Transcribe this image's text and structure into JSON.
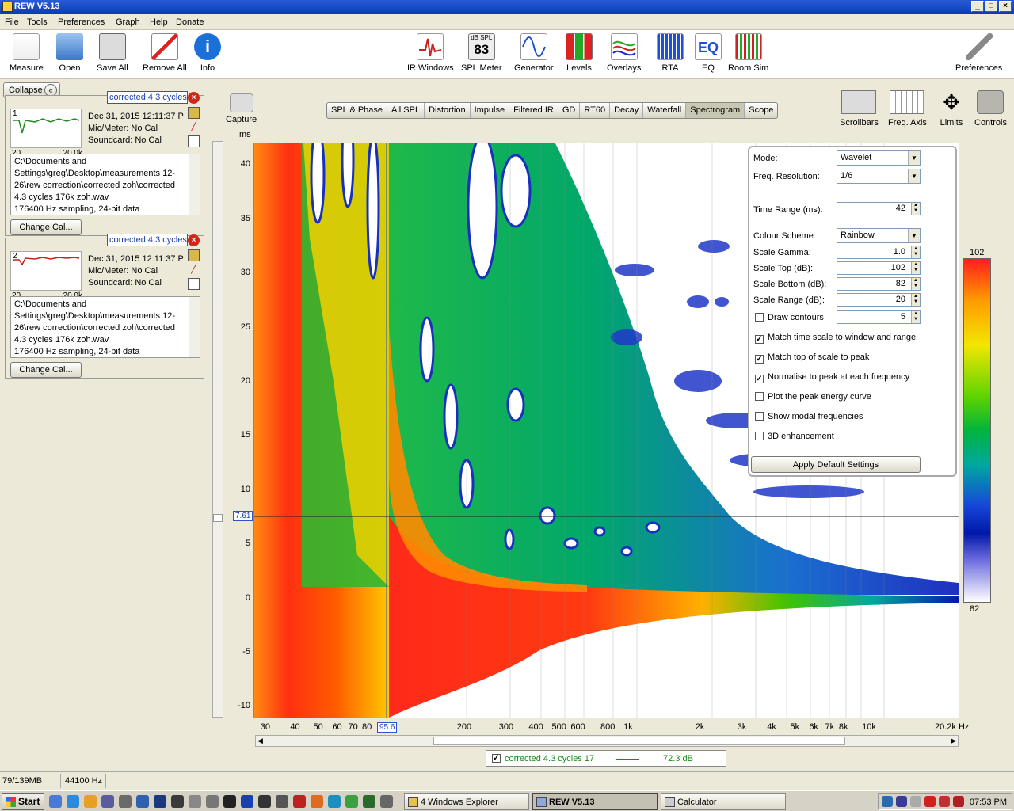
{
  "window": {
    "title": "REW V5.13"
  },
  "menu": [
    "File",
    "Tools",
    "Preferences",
    "Graph",
    "Help",
    "Donate"
  ],
  "toolbar": {
    "left": [
      {
        "label": "Measure",
        "icon": "measure-icon"
      },
      {
        "label": "Open",
        "icon": "folder-icon"
      },
      {
        "label": "Save All",
        "icon": "save-icon"
      },
      {
        "label": "Remove All",
        "icon": "remove-all-icon"
      },
      {
        "label": "Info",
        "icon": "info-icon"
      }
    ],
    "center": [
      {
        "label": "IR Windows",
        "icon": "ir-windows-icon"
      },
      {
        "label": "SPL Meter",
        "icon": "spl-meter-icon",
        "badge_top": "dB SPL",
        "badge_value": "83"
      },
      {
        "label": "Generator",
        "icon": "generator-icon"
      },
      {
        "label": "Levels",
        "icon": "levels-icon"
      },
      {
        "label": "Overlays",
        "icon": "overlays-icon"
      },
      {
        "label": "RTA",
        "icon": "rta-icon"
      },
      {
        "label": "EQ",
        "icon": "eq-icon"
      },
      {
        "label": "Room Sim",
        "icon": "room-sim-icon"
      }
    ],
    "right": {
      "label": "Preferences",
      "icon": "wrench-icon"
    }
  },
  "leftpanel": {
    "collapse_label": "Collapse",
    "measurements": [
      {
        "index": "1",
        "name": "corrected 4.3 cycles 17",
        "date": "Dec 31, 2015 12:11:37 P",
        "mic": "Mic/Meter: No Cal",
        "soundcard": "Soundcard: No Cal",
        "thumb_left": "20",
        "thumb_right": "20.0k",
        "path": "C:\\Documents and Settings\\greg\\Desktop\\measurements 12-26\\rew correction\\corrected zoh\\corrected 4.3 cycles 176k zoh.wav",
        "sampling": "176400 Hz sampling, 24-bit data",
        "change_cal": "Change Cal...",
        "trace_color": "#1f8a1f"
      },
      {
        "index": "2",
        "name": "corrected 4.3 cycles 17",
        "date": "Dec 31, 2015 12:11:37 P",
        "mic": "Mic/Meter: No Cal",
        "soundcard": "Soundcard: No Cal",
        "thumb_left": "20",
        "thumb_right": "20.0k",
        "path": "C:\\Documents and Settings\\greg\\Desktop\\measurements 12-26\\rew correction\\corrected zoh\\corrected 4.3 cycles 176k zoh.wav",
        "sampling": "176400 Hz sampling, 24-bit data",
        "change_cal": "Change Cal...",
        "trace_color": "#c0201a"
      }
    ]
  },
  "graph": {
    "capture_label": "Capture",
    "tabs": [
      "SPL & Phase",
      "All SPL",
      "Distortion",
      "Impulse",
      "Filtered IR",
      "GD",
      "RT60",
      "Decay",
      "Waterfall",
      "Spectrogram",
      "Scope"
    ],
    "active_tab": "Spectrogram",
    "right_buttons": [
      "Scrollbars",
      "Freq. Axis",
      "Limits",
      "Controls"
    ],
    "y_unit": "ms",
    "y_ticks": [
      "40",
      "35",
      "30",
      "25",
      "20",
      "15",
      "10",
      "5",
      "0",
      "-5",
      "-10"
    ],
    "x_ticks": [
      "30",
      "40",
      "50",
      "60",
      "70",
      "80",
      "200",
      "300",
      "400",
      "500",
      "600",
      "800",
      "1k",
      "2k",
      "3k",
      "4k",
      "5k",
      "6k",
      "7k",
      "8k",
      "10k",
      "20.2k Hz"
    ],
    "cursor_time": "7.61",
    "cursor_freq": "95.6",
    "colorbar_top": "102",
    "colorbar_bottom": "82"
  },
  "controls": {
    "mode_label": "Mode:",
    "mode_value": "Wavelet",
    "freqres_label": "Freq. Resolution:",
    "freqres_value": "1/6",
    "timerange_label": "Time Range (ms):",
    "timerange_value": "42",
    "scheme_label": "Colour Scheme:",
    "scheme_value": "Rainbow",
    "gamma_label": "Scale Gamma:",
    "gamma_value": "1.0",
    "top_label": "Scale Top (dB):",
    "top_value": "102",
    "bottom_label": "Scale Bottom (dB):",
    "bottom_value": "82",
    "range_label": "Scale Range (dB):",
    "range_value": "20",
    "contours_label": "Draw contours",
    "contours_value": "5",
    "checks": [
      {
        "label": "Match time scale to window and range",
        "checked": true
      },
      {
        "label": "Match top of scale to peak",
        "checked": true
      },
      {
        "label": "Normalise to peak at each frequency",
        "checked": true
      },
      {
        "label": "Plot the peak energy curve",
        "checked": false
      },
      {
        "label": "Show modal frequencies",
        "checked": false
      },
      {
        "label": "3D enhancement",
        "checked": false
      }
    ],
    "apply_label": "Apply Default Settings"
  },
  "legend": {
    "name": "corrected 4.3 cycles 17",
    "value": "72.3 dB",
    "color": "#188b1a"
  },
  "status": {
    "memory": "79/139MB",
    "rate": "44100 Hz"
  },
  "taskbar": {
    "start": "Start",
    "tasks": [
      "4 Windows Explorer",
      "REW V5.13",
      "Calculator"
    ],
    "clock": "07:53 PM"
  }
}
